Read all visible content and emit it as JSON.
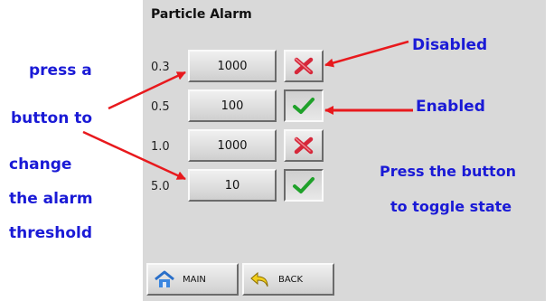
{
  "screen": {
    "title": "Particle Alarm",
    "rows": [
      {
        "size": "0.3",
        "threshold": "1000",
        "state": "disabled",
        "toggle_icon": "cross-icon"
      },
      {
        "size": "0.5",
        "threshold": "100",
        "state": "enabled",
        "toggle_icon": "check-icon"
      },
      {
        "size": "1.0",
        "threshold": "1000",
        "state": "disabled",
        "toggle_icon": "cross-icon"
      },
      {
        "size": "5.0",
        "threshold": "10",
        "state": "enabled",
        "toggle_icon": "check-icon"
      }
    ],
    "nav": {
      "main_label": "MAIN",
      "main_icon": "home-icon",
      "back_label": "BACK",
      "back_icon": "back-arrow-icon"
    }
  },
  "annotations": {
    "left_lines": [
      "press a",
      "button to",
      "change",
      "the alarm",
      "threshold"
    ],
    "disabled": "Disabled",
    "enabled": "Enabled",
    "toggle_lines": [
      "Press the button",
      "to toggle state"
    ],
    "text_color": "#1a1ad6",
    "arrow_color": "#e8191d"
  },
  "colors": {
    "panel_bg": "#d9d9d9",
    "cross": "#d6273a",
    "check": "#1fa12a"
  }
}
